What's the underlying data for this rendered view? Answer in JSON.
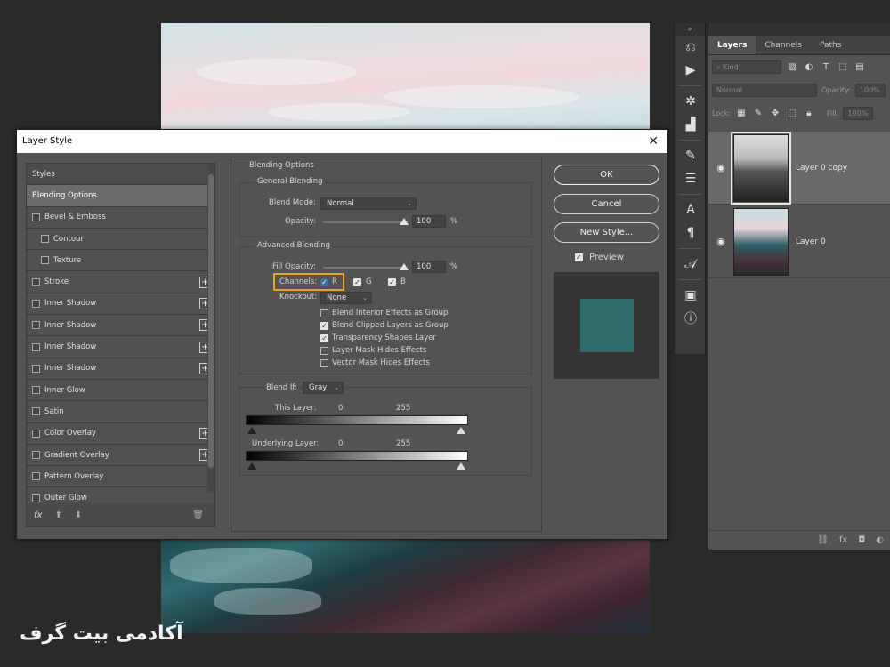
{
  "watermark": "آکادمی بیت گرف",
  "dialog": {
    "title": "Layer Style",
    "styles": [
      {
        "label": "Styles",
        "kind": "header",
        "checkbox": false,
        "plus": false
      },
      {
        "label": "Blending Options",
        "kind": "active",
        "checkbox": false,
        "plus": false
      },
      {
        "label": "Bevel & Emboss",
        "kind": "normal",
        "checkbox": true,
        "plus": false
      },
      {
        "label": "Contour",
        "kind": "sub",
        "checkbox": true,
        "plus": false
      },
      {
        "label": "Texture",
        "kind": "sub",
        "checkbox": true,
        "plus": false
      },
      {
        "label": "Stroke",
        "kind": "normal",
        "checkbox": true,
        "plus": true
      },
      {
        "label": "Inner Shadow",
        "kind": "normal",
        "checkbox": true,
        "plus": true
      },
      {
        "label": "Inner Shadow",
        "kind": "normal",
        "checkbox": true,
        "plus": true
      },
      {
        "label": "Inner Shadow",
        "kind": "normal",
        "checkbox": true,
        "plus": true
      },
      {
        "label": "Inner Shadow",
        "kind": "normal",
        "checkbox": true,
        "plus": true
      },
      {
        "label": "Inner Glow",
        "kind": "normal",
        "checkbox": true,
        "plus": false
      },
      {
        "label": "Satin",
        "kind": "normal",
        "checkbox": true,
        "plus": false
      },
      {
        "label": "Color Overlay",
        "kind": "normal",
        "checkbox": true,
        "plus": true
      },
      {
        "label": "Gradient Overlay",
        "kind": "normal",
        "checkbox": true,
        "plus": true
      },
      {
        "label": "Pattern Overlay",
        "kind": "normal",
        "checkbox": true,
        "plus": false
      },
      {
        "label": "Outer Glow",
        "kind": "normal",
        "checkbox": true,
        "plus": false
      }
    ],
    "footer_icons": [
      "fx-icon",
      "up-arrow-icon",
      "down-arrow-icon",
      "trash-icon"
    ],
    "blending": {
      "section_title": "Blending Options",
      "general_title": "General Blending",
      "blend_mode_label": "Blend Mode:",
      "blend_mode_value": "Normal",
      "opacity_label": "Opacity:",
      "opacity_value": "100",
      "opacity_unit": "%",
      "advanced_title": "Advanced Blending",
      "fill_opacity_label": "Fill Opacity:",
      "fill_opacity_value": "100",
      "fill_opacity_unit": "%",
      "channels_label": "Channels:",
      "channel_r": "R",
      "channel_g": "G",
      "channel_b": "B",
      "knockout_label": "Knockout:",
      "knockout_value": "None",
      "options": [
        {
          "label": "Blend Interior Effects as Group",
          "checked": false
        },
        {
          "label": "Blend Clipped Layers as Group",
          "checked": true
        },
        {
          "label": "Transparency Shapes Layer",
          "checked": true
        },
        {
          "label": "Layer Mask Hides Effects",
          "checked": false
        },
        {
          "label": "Vector Mask Hides Effects",
          "checked": false
        }
      ],
      "blend_if_label": "Blend If:",
      "blend_if_value": "Gray",
      "this_layer_label": "This Layer:",
      "this_layer_min": "0",
      "this_layer_max": "255",
      "underlying_label": "Underlying Layer:",
      "underlying_min": "0",
      "underlying_max": "255"
    },
    "buttons": {
      "ok": "OK",
      "cancel": "Cancel",
      "new_style": "New Style...",
      "preview": "Preview"
    },
    "preview_color": "#2f6a6c"
  },
  "layers_panel": {
    "tabs": [
      "Layers",
      "Channels",
      "Paths"
    ],
    "kind_placeholder": "Kind",
    "blend_mode": "Normal",
    "opacity_label": "Opacity:",
    "opacity_value": "100%",
    "lock_label": "Lock:",
    "fill_label": "Fill:",
    "fill_value": "100%",
    "layers": [
      {
        "name": "Layer 0 copy",
        "selected": true
      },
      {
        "name": "Layer 0",
        "selected": false
      }
    ]
  },
  "colors": {
    "highlight": "#f0a11a"
  }
}
